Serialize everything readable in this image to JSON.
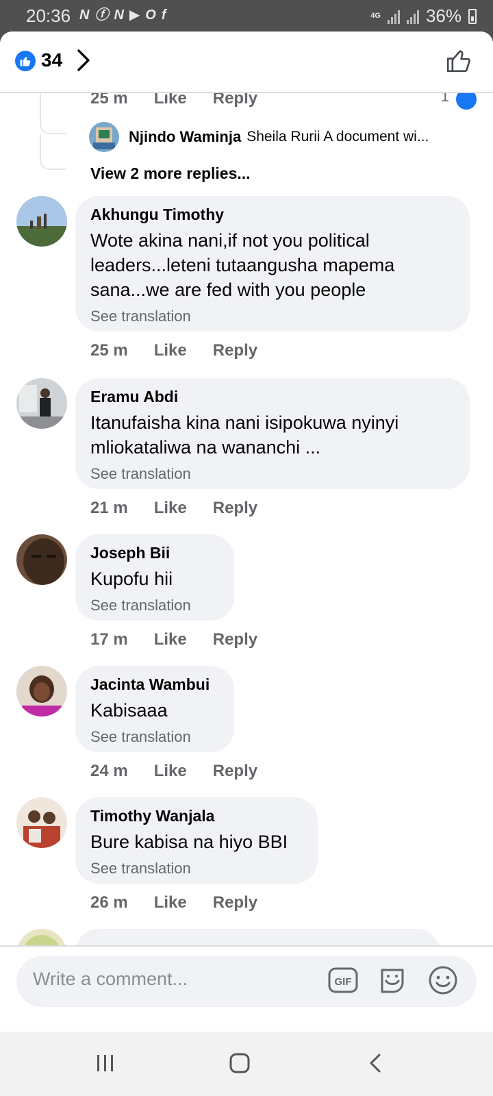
{
  "status_bar": {
    "time": "20:36",
    "battery": "36%",
    "network": "4G",
    "notification_icons": [
      "N",
      "fb",
      "N",
      "yt",
      "opera",
      "fb-square"
    ]
  },
  "header": {
    "like_count": "34",
    "colors": {
      "accent": "#1877f2"
    }
  },
  "partial_comment": {
    "time": "25 m",
    "like": "Like",
    "reply": "Reply",
    "reaction_count": "1"
  },
  "reply_preview": {
    "name": "Njindo Waminja",
    "text": "Sheila Rurii A document wi...",
    "view_more": "View 2 more replies..."
  },
  "comments": [
    {
      "name": "Akhungu Timothy",
      "text": "Wote akina nani,if not you political leaders...leteni tutaangusha mapema sana...we are fed with you people",
      "translation": "See translation",
      "time": "25 m",
      "like": "Like",
      "reply": "Reply"
    },
    {
      "name": "Eramu Abdi",
      "text": "Itanufaisha kina nani isipokuwa nyinyi mliokataliwa na wananchi ...",
      "translation": "See translation",
      "time": "21 m",
      "like": "Like",
      "reply": "Reply"
    },
    {
      "name": "Joseph Bii",
      "text": "Kupofu hii",
      "translation": "See translation",
      "time": "17 m",
      "like": "Like",
      "reply": "Reply"
    },
    {
      "name": "Jacinta Wambui",
      "text": "Kabisaaa",
      "translation": "See translation",
      "time": "24 m",
      "like": "Like",
      "reply": "Reply"
    },
    {
      "name": "Timothy Wanjala",
      "text": "Bure kabisa na hiyo BBI",
      "translation": "See translation",
      "time": "26 m",
      "like": "Like",
      "reply": "Reply"
    }
  ],
  "composer": {
    "placeholder": "Write a comment...",
    "gif_label": "GIF"
  }
}
